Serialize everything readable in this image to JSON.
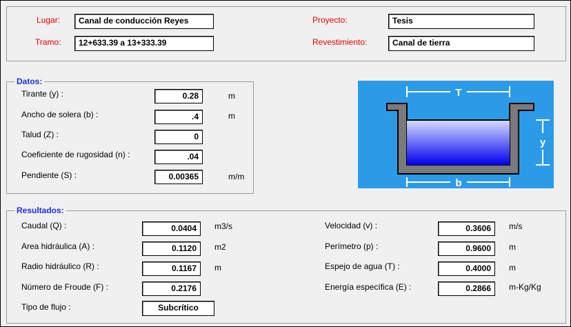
{
  "header": {
    "lugar_label": "Lugar:",
    "lugar_value": "Canal de conducción Reyes",
    "tramo_label": "Tramo:",
    "tramo_value": "12+633.39 a 13+333.39",
    "proyecto_label": "Proyecto:",
    "proyecto_value": "Tesis",
    "revestimiento_label": "Revestimiento:",
    "revestimiento_value": "Canal de tierra"
  },
  "datos": {
    "title": "Datos:",
    "tirante": {
      "label": "Tirante (y) :",
      "value": "0.28",
      "unit": "m"
    },
    "ancho": {
      "label": "Ancho de solera (b) :",
      "value": ".4",
      "unit": "m"
    },
    "talud": {
      "label": "Talud  (Z) :",
      "value": "0",
      "unit": ""
    },
    "rugosidad": {
      "label": "Coeficiente de rugosidad (n) :",
      "value": ".04",
      "unit": ""
    },
    "pendiente": {
      "label": "Pendiente (S) :",
      "value": "0.00365",
      "unit": "m/m"
    }
  },
  "diagram": {
    "top_label": "T",
    "depth_label": "y",
    "bottom_label": "b",
    "colors": {
      "background": "#2b9be8",
      "channel": "#7a7a7a",
      "water_top": "#d8dcff",
      "water_bottom": "#0000ee"
    }
  },
  "resultados": {
    "title": "Resultados:",
    "caudal": {
      "label": "Caudal (Q) :",
      "value": "0.0404",
      "unit": "m3/s"
    },
    "area": {
      "label": "Area hidráulica (A) :",
      "value": "0.1120",
      "unit": "m2"
    },
    "radio": {
      "label": "Radio hidráulico (R) :",
      "value": "0.1167",
      "unit": "m"
    },
    "froude": {
      "label": "Número de Froude (F) :",
      "value": "0.2176",
      "unit": ""
    },
    "tipo": {
      "label": "Tipo de flujo :",
      "value": "Subcrítico"
    },
    "velocidad": {
      "label": "Velocidad (v) :",
      "value": "0.3606",
      "unit": "m/s"
    },
    "perimetro": {
      "label": "Perímetro (p) :",
      "value": "0.9600",
      "unit": "m"
    },
    "espejo": {
      "label": "Espejo de agua (T) :",
      "value": "0.4000",
      "unit": "m"
    },
    "energia": {
      "label": "Energía específica (E) :",
      "value": "0.2866",
      "unit": "m-Kg/Kg"
    }
  }
}
